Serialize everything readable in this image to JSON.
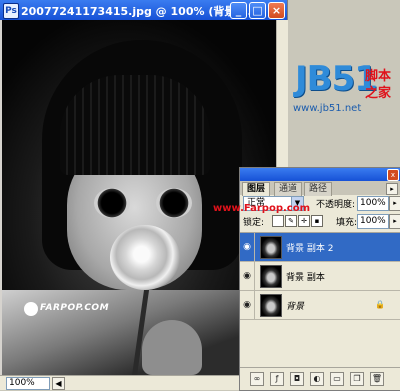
{
  "window": {
    "title": "20077241173415.jpg @ 100% (背景 ...",
    "min_label": "_",
    "max_label": "□",
    "close_label": "×",
    "zoom": "100%",
    "status_arrow": "◀"
  },
  "photo": {
    "watermark": "FARPOP.COM",
    "overlay_url": "www.Farpop.com"
  },
  "logo": {
    "brand": "JB51",
    "cn_line1": "脚本",
    "cn_line2": "之家",
    "url": "www.jb51.net"
  },
  "layers_panel": {
    "tabs": [
      "图层",
      "通道",
      "路径"
    ],
    "active_tab": "图层",
    "menu_label": "▸",
    "close_label": "x",
    "blend_mode": "正常",
    "opacity_label": "不透明度:",
    "opacity": "100%",
    "lock_label": "锁定:",
    "fill_label": "填充:",
    "fill": "100%",
    "layers": [
      {
        "name": "背景 副本 2",
        "selected": true,
        "visible": true,
        "italic": false,
        "locked": false
      },
      {
        "name": "背景 副本",
        "selected": false,
        "visible": true,
        "italic": false,
        "locked": false
      },
      {
        "name": "背景",
        "selected": false,
        "visible": true,
        "italic": true,
        "locked": true
      }
    ]
  },
  "colors": {
    "title_bar": "#1651d6",
    "selected_layer": "#316ac5",
    "logo_blue": "#2f8bd9",
    "logo_red": "#e0121b"
  }
}
